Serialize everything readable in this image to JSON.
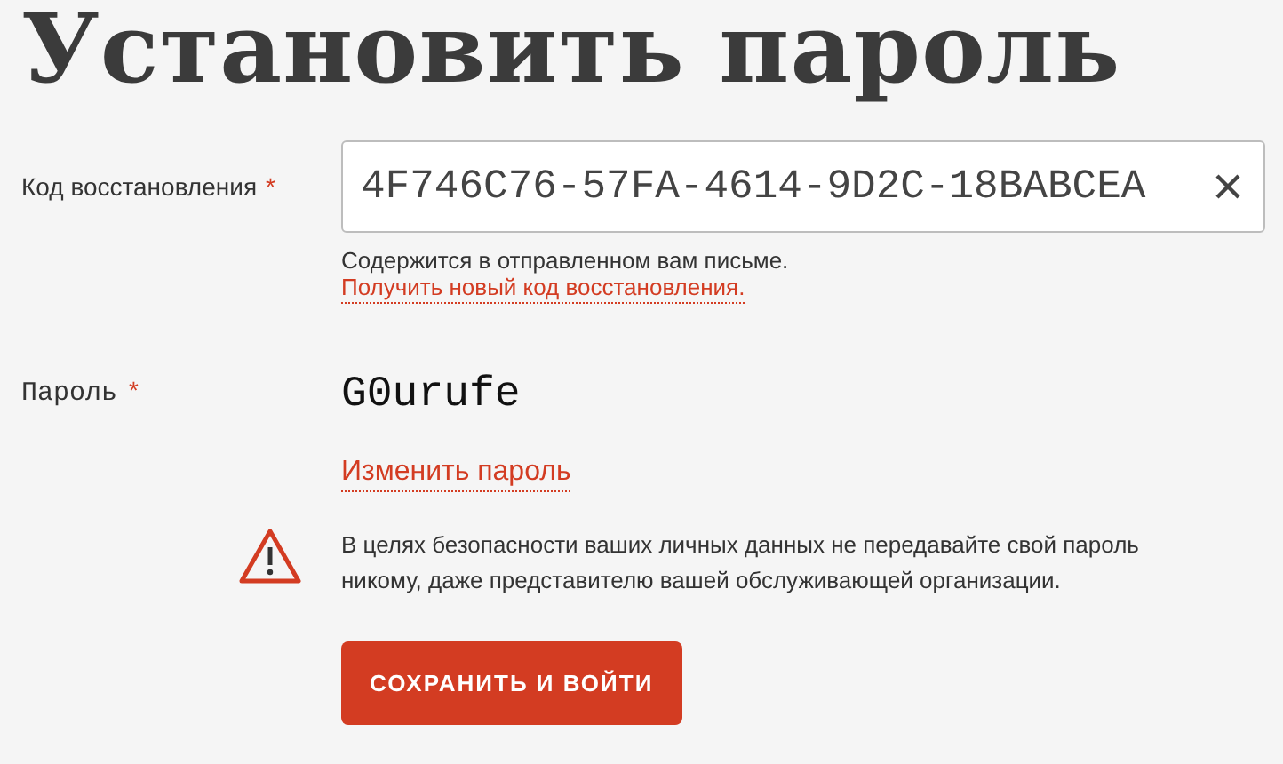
{
  "title": "Установить пароль",
  "recovery_code": {
    "label": "Код восстановления",
    "required_mark": "*",
    "value": "4F746C76-57FA-4614-9D2C-18BABCEA",
    "hint": "Содержится в отправленном вам письме.",
    "link": "Получить новый код восстановления."
  },
  "password": {
    "label": "Пароль",
    "required_mark": "*",
    "value": "G0urufe",
    "link": "Изменить пароль"
  },
  "warning": "В целях безопасности ваших личных данных не передавайте свой пароль никому, даже представителю вашей обслуживающей организации.",
  "submit_button": "СОХРАНИТЬ И ВОЙТИ"
}
